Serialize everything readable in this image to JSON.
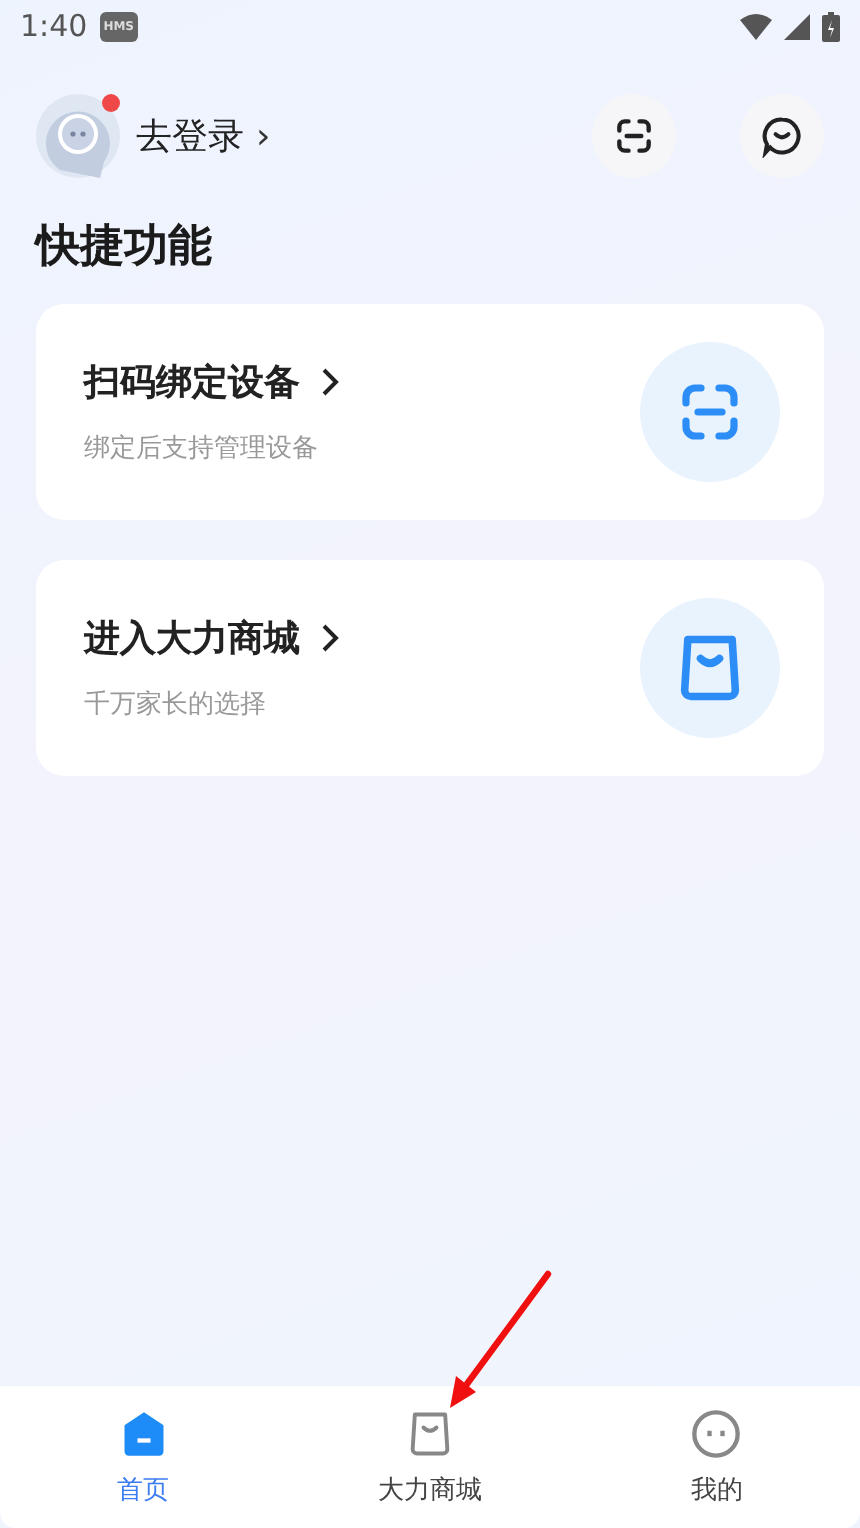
{
  "status_bar": {
    "time": "1:40",
    "badge": "HMS"
  },
  "header": {
    "login_label": "去登录",
    "chevron": "›",
    "notification_dot": true
  },
  "section_title": "快捷功能",
  "cards": [
    {
      "kind": "scan",
      "title": "扫码绑定设备",
      "subtitle": "绑定后支持管理设备"
    },
    {
      "kind": "shop",
      "title": "进入大力商城",
      "subtitle": "千万家长的选择"
    }
  ],
  "tabs": [
    {
      "kind": "home",
      "label": "首页",
      "selected": true
    },
    {
      "kind": "shop",
      "label": "大力商城",
      "selected": false
    },
    {
      "kind": "me",
      "label": "我的",
      "selected": false
    }
  ]
}
